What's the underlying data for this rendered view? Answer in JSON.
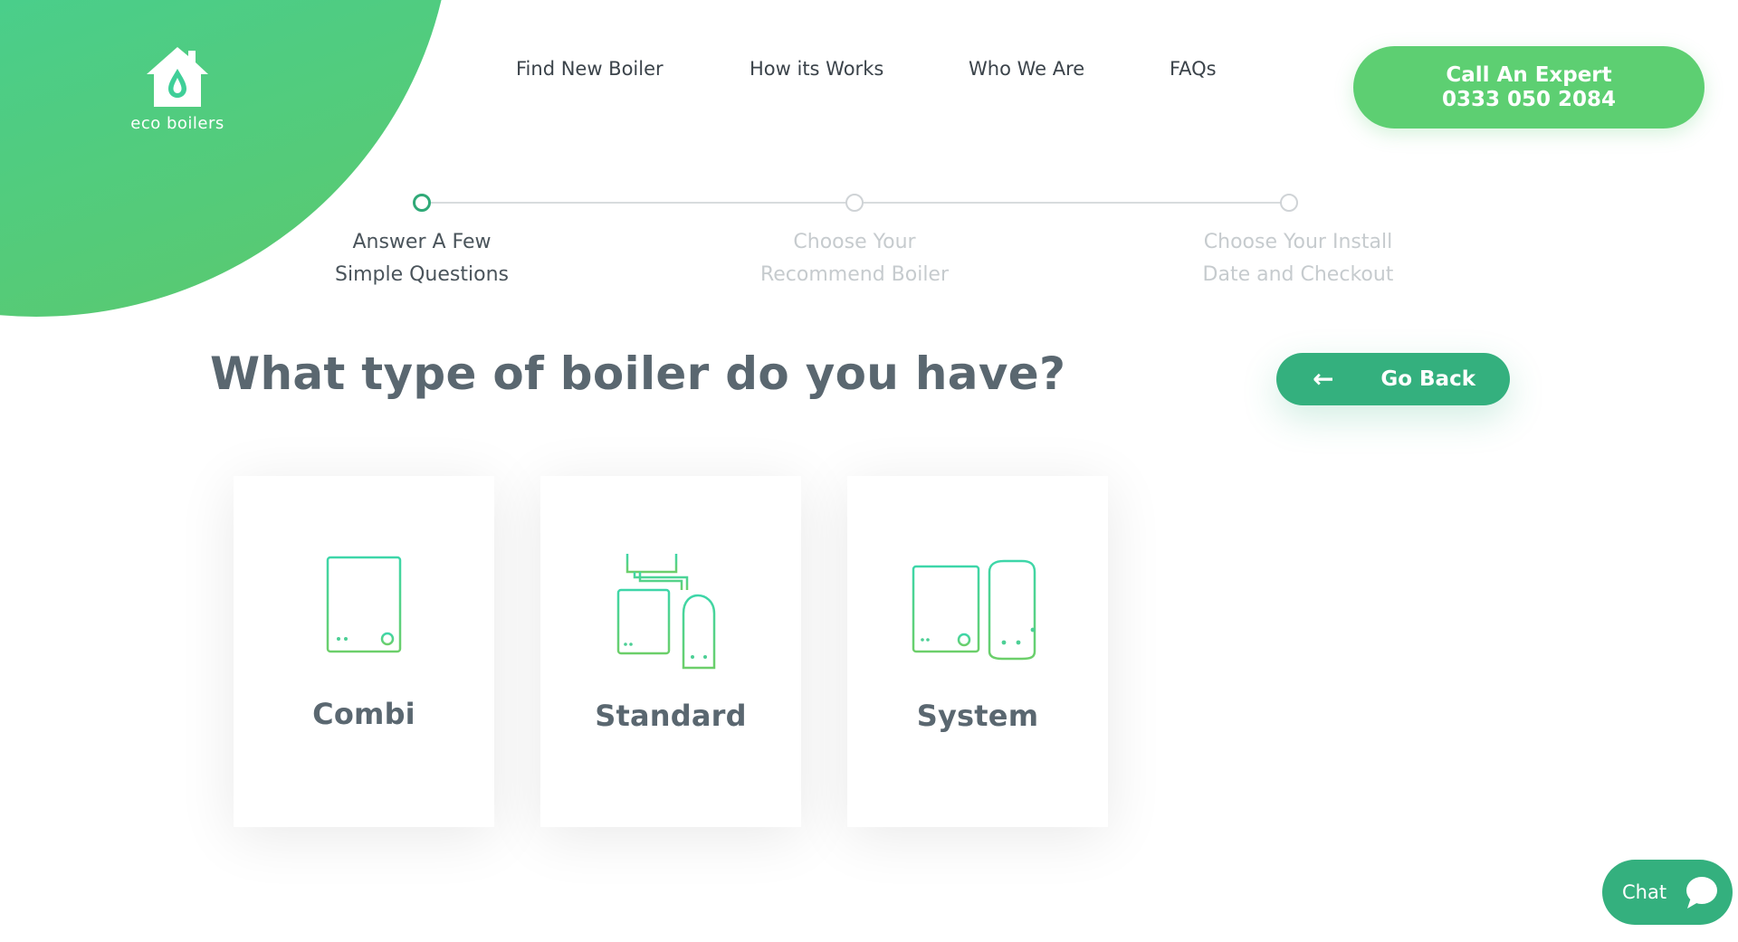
{
  "brand": {
    "name": "eco boilers",
    "accent": "#3dd6a9",
    "green": "#5dcf72",
    "dark_green": "#34b07e"
  },
  "nav": {
    "items": [
      {
        "label": "Find New Boiler"
      },
      {
        "label": "How its Works"
      },
      {
        "label": "Who We Are"
      },
      {
        "label": "FAQs"
      }
    ],
    "cta_line1": "Call An Expert",
    "cta_line2": "0333 050 2084"
  },
  "progress": {
    "steps": [
      {
        "line1": "Answer A Few",
        "line2": "Simple Questions",
        "state": "active"
      },
      {
        "line1": "Choose Your",
        "line2": "Recommend Boiler",
        "state": "inactive"
      },
      {
        "line1": "Choose Your Install",
        "line2": "Date and Checkout",
        "state": "inactive"
      }
    ]
  },
  "question": {
    "title": "What type of boiler do you have?",
    "back_label": "Go Back",
    "back_icon": "arrow-left-icon"
  },
  "options": [
    {
      "label": "Combi",
      "icon": "combi-boiler-icon"
    },
    {
      "label": "Standard",
      "icon": "standard-boiler-icon"
    },
    {
      "label": "System",
      "icon": "system-boiler-icon"
    }
  ],
  "chat": {
    "label": "Chat",
    "icon": "chat-bubble-icon"
  }
}
